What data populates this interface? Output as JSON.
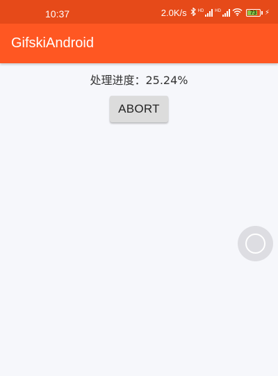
{
  "status_bar": {
    "time": "10:37",
    "network_speed": "2.0K/s",
    "signal_tag_1": "HD",
    "signal_tag_2": "HD",
    "battery_level": "73",
    "icons": [
      "bluetooth-icon",
      "signal-icon",
      "signal-icon",
      "wifi-icon",
      "battery-icon",
      "charging-icon"
    ]
  },
  "app_bar": {
    "title": "GifskiAndroid",
    "color": "#ff5722",
    "status_color": "#e64a19"
  },
  "main": {
    "progress_text": "处理进度：25.24%",
    "abort_label": "ABORT"
  },
  "floating_ball": {
    "icon": "floating-ball-icon"
  }
}
